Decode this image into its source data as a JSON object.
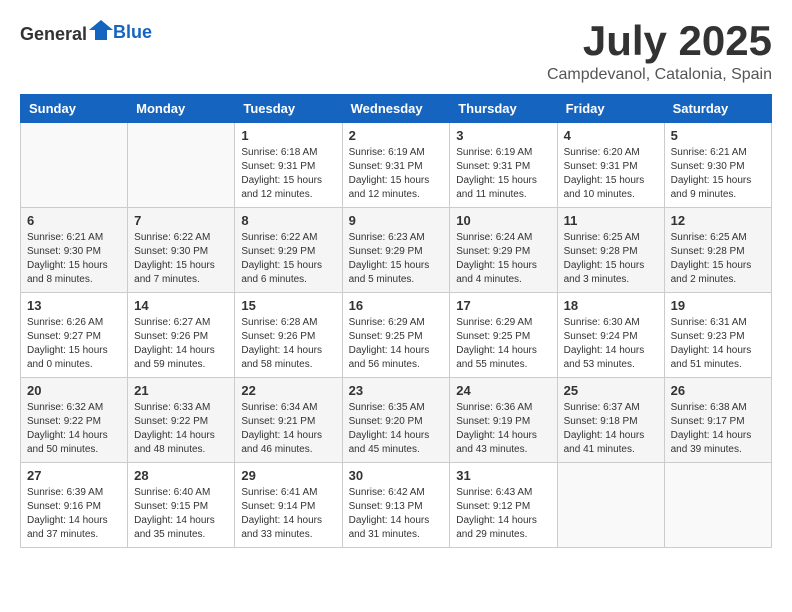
{
  "header": {
    "logo_general": "General",
    "logo_blue": "Blue",
    "month_title": "July 2025",
    "location": "Campdevanol, Catalonia, Spain"
  },
  "weekdays": [
    "Sunday",
    "Monday",
    "Tuesday",
    "Wednesday",
    "Thursday",
    "Friday",
    "Saturday"
  ],
  "weeks": [
    [
      {
        "day": "",
        "info": ""
      },
      {
        "day": "",
        "info": ""
      },
      {
        "day": "1",
        "info": "Sunrise: 6:18 AM\nSunset: 9:31 PM\nDaylight: 15 hours and 12 minutes."
      },
      {
        "day": "2",
        "info": "Sunrise: 6:19 AM\nSunset: 9:31 PM\nDaylight: 15 hours and 12 minutes."
      },
      {
        "day": "3",
        "info": "Sunrise: 6:19 AM\nSunset: 9:31 PM\nDaylight: 15 hours and 11 minutes."
      },
      {
        "day": "4",
        "info": "Sunrise: 6:20 AM\nSunset: 9:31 PM\nDaylight: 15 hours and 10 minutes."
      },
      {
        "day": "5",
        "info": "Sunrise: 6:21 AM\nSunset: 9:30 PM\nDaylight: 15 hours and 9 minutes."
      }
    ],
    [
      {
        "day": "6",
        "info": "Sunrise: 6:21 AM\nSunset: 9:30 PM\nDaylight: 15 hours and 8 minutes."
      },
      {
        "day": "7",
        "info": "Sunrise: 6:22 AM\nSunset: 9:30 PM\nDaylight: 15 hours and 7 minutes."
      },
      {
        "day": "8",
        "info": "Sunrise: 6:22 AM\nSunset: 9:29 PM\nDaylight: 15 hours and 6 minutes."
      },
      {
        "day": "9",
        "info": "Sunrise: 6:23 AM\nSunset: 9:29 PM\nDaylight: 15 hours and 5 minutes."
      },
      {
        "day": "10",
        "info": "Sunrise: 6:24 AM\nSunset: 9:29 PM\nDaylight: 15 hours and 4 minutes."
      },
      {
        "day": "11",
        "info": "Sunrise: 6:25 AM\nSunset: 9:28 PM\nDaylight: 15 hours and 3 minutes."
      },
      {
        "day": "12",
        "info": "Sunrise: 6:25 AM\nSunset: 9:28 PM\nDaylight: 15 hours and 2 minutes."
      }
    ],
    [
      {
        "day": "13",
        "info": "Sunrise: 6:26 AM\nSunset: 9:27 PM\nDaylight: 15 hours and 0 minutes."
      },
      {
        "day": "14",
        "info": "Sunrise: 6:27 AM\nSunset: 9:26 PM\nDaylight: 14 hours and 59 minutes."
      },
      {
        "day": "15",
        "info": "Sunrise: 6:28 AM\nSunset: 9:26 PM\nDaylight: 14 hours and 58 minutes."
      },
      {
        "day": "16",
        "info": "Sunrise: 6:29 AM\nSunset: 9:25 PM\nDaylight: 14 hours and 56 minutes."
      },
      {
        "day": "17",
        "info": "Sunrise: 6:29 AM\nSunset: 9:25 PM\nDaylight: 14 hours and 55 minutes."
      },
      {
        "day": "18",
        "info": "Sunrise: 6:30 AM\nSunset: 9:24 PM\nDaylight: 14 hours and 53 minutes."
      },
      {
        "day": "19",
        "info": "Sunrise: 6:31 AM\nSunset: 9:23 PM\nDaylight: 14 hours and 51 minutes."
      }
    ],
    [
      {
        "day": "20",
        "info": "Sunrise: 6:32 AM\nSunset: 9:22 PM\nDaylight: 14 hours and 50 minutes."
      },
      {
        "day": "21",
        "info": "Sunrise: 6:33 AM\nSunset: 9:22 PM\nDaylight: 14 hours and 48 minutes."
      },
      {
        "day": "22",
        "info": "Sunrise: 6:34 AM\nSunset: 9:21 PM\nDaylight: 14 hours and 46 minutes."
      },
      {
        "day": "23",
        "info": "Sunrise: 6:35 AM\nSunset: 9:20 PM\nDaylight: 14 hours and 45 minutes."
      },
      {
        "day": "24",
        "info": "Sunrise: 6:36 AM\nSunset: 9:19 PM\nDaylight: 14 hours and 43 minutes."
      },
      {
        "day": "25",
        "info": "Sunrise: 6:37 AM\nSunset: 9:18 PM\nDaylight: 14 hours and 41 minutes."
      },
      {
        "day": "26",
        "info": "Sunrise: 6:38 AM\nSunset: 9:17 PM\nDaylight: 14 hours and 39 minutes."
      }
    ],
    [
      {
        "day": "27",
        "info": "Sunrise: 6:39 AM\nSunset: 9:16 PM\nDaylight: 14 hours and 37 minutes."
      },
      {
        "day": "28",
        "info": "Sunrise: 6:40 AM\nSunset: 9:15 PM\nDaylight: 14 hours and 35 minutes."
      },
      {
        "day": "29",
        "info": "Sunrise: 6:41 AM\nSunset: 9:14 PM\nDaylight: 14 hours and 33 minutes."
      },
      {
        "day": "30",
        "info": "Sunrise: 6:42 AM\nSunset: 9:13 PM\nDaylight: 14 hours and 31 minutes."
      },
      {
        "day": "31",
        "info": "Sunrise: 6:43 AM\nSunset: 9:12 PM\nDaylight: 14 hours and 29 minutes."
      },
      {
        "day": "",
        "info": ""
      },
      {
        "day": "",
        "info": ""
      }
    ]
  ]
}
